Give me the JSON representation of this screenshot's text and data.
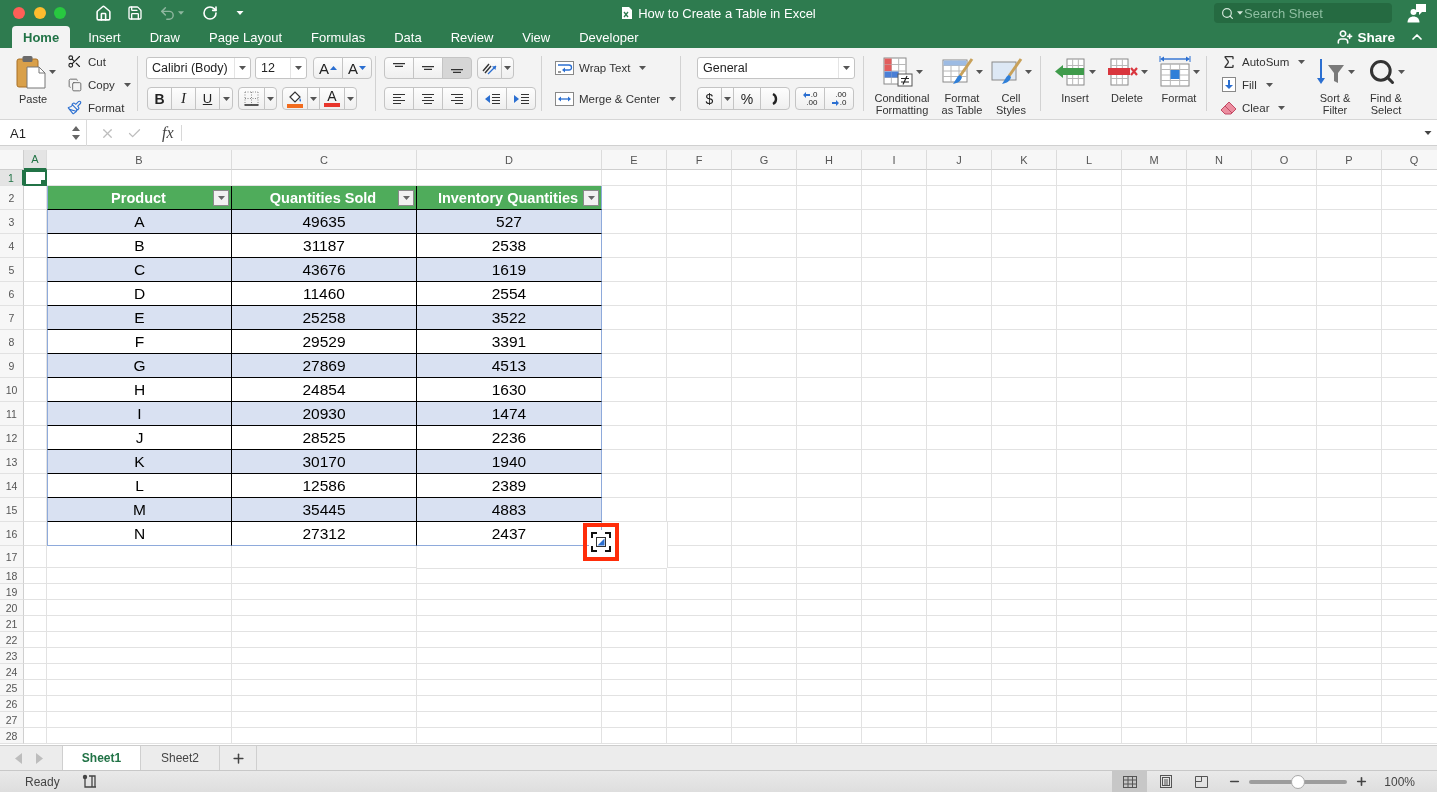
{
  "window": {
    "title": "How to Create a Table in Excel"
  },
  "search": {
    "placeholder": "Search Sheet"
  },
  "tabs": [
    {
      "label": "Home",
      "selected": true
    },
    {
      "label": "Insert",
      "selected": false
    },
    {
      "label": "Draw",
      "selected": false
    },
    {
      "label": "Page Layout",
      "selected": false
    },
    {
      "label": "Formulas",
      "selected": false
    },
    {
      "label": "Data",
      "selected": false
    },
    {
      "label": "Review",
      "selected": false
    },
    {
      "label": "View",
      "selected": false
    },
    {
      "label": "Developer",
      "selected": false
    }
  ],
  "share": {
    "label": "Share"
  },
  "ribbon": {
    "clipboard": {
      "paste": "Paste",
      "cut": "Cut",
      "copy": "Copy",
      "format": "Format"
    },
    "font": {
      "name": "Calibri (Body)",
      "size": "12",
      "grow": "A",
      "shrink": "A",
      "bold": "B",
      "italic": "I",
      "underline": "U",
      "font_color": "A"
    },
    "alignment": {
      "vertical": [
        {
          "kind": "top",
          "selected": false
        },
        {
          "kind": "middle",
          "selected": false
        },
        {
          "kind": "bottom",
          "selected": true
        }
      ],
      "wrap_text": "Wrap Text",
      "merge_center": "Merge & Center"
    },
    "number": {
      "format": "General",
      "currency": "$",
      "percent": "%",
      "increase_decimal": {
        "top": ".0",
        "bottom": ".00"
      },
      "decrease_decimal": {
        "top": ".00",
        "bottom": ".0"
      }
    },
    "styles": [
      {
        "kind": "conditional",
        "label": "Conditional Formatting"
      },
      {
        "kind": "table",
        "label": "Format as Table"
      },
      {
        "kind": "cell",
        "label": "Cell Styles"
      }
    ],
    "cells": [
      {
        "kind": "insert",
        "label": "Insert"
      },
      {
        "kind": "delete",
        "label": "Delete"
      },
      {
        "kind": "format",
        "label": "Format"
      }
    ],
    "editing": {
      "autosum": "AutoSum",
      "fill": "Fill",
      "clear": "Clear",
      "sort_filter": "Sort & Filter",
      "find_select": "Find & Select"
    }
  },
  "formula_bar": {
    "name_box": "A1",
    "function_label": "fx"
  },
  "sheet": {
    "columns": [
      {
        "label": "A",
        "selected": true
      },
      {
        "label": "B",
        "selected": false
      },
      {
        "label": "C",
        "selected": false
      },
      {
        "label": "D",
        "selected": false
      },
      {
        "label": "E",
        "selected": false
      },
      {
        "label": "F",
        "selected": false
      },
      {
        "label": "G",
        "selected": false
      },
      {
        "label": "H",
        "selected": false
      },
      {
        "label": "I",
        "selected": false
      },
      {
        "label": "J",
        "selected": false
      },
      {
        "label": "K",
        "selected": false
      },
      {
        "label": "L",
        "selected": false
      },
      {
        "label": "M",
        "selected": false
      },
      {
        "label": "N",
        "selected": false
      },
      {
        "label": "O",
        "selected": false
      },
      {
        "label": "P",
        "selected": false
      },
      {
        "label": "Q",
        "selected": false
      }
    ],
    "rows": [
      {
        "label": "1",
        "selected": true
      },
      {
        "label": "2",
        "selected": false
      },
      {
        "label": "3",
        "selected": false
      },
      {
        "label": "4",
        "selected": false
      },
      {
        "label": "5",
        "selected": false
      },
      {
        "label": "6",
        "selected": false
      },
      {
        "label": "7",
        "selected": false
      },
      {
        "label": "8",
        "selected": false
      },
      {
        "label": "9",
        "selected": false
      },
      {
        "label": "10",
        "selected": false
      },
      {
        "label": "11",
        "selected": false
      },
      {
        "label": "12",
        "selected": false
      },
      {
        "label": "13",
        "selected": false
      },
      {
        "label": "14",
        "selected": false
      },
      {
        "label": "15",
        "selected": false
      },
      {
        "label": "16",
        "selected": false
      },
      {
        "label": "17",
        "selected": false
      },
      {
        "label": "18",
        "selected": false
      },
      {
        "label": "19",
        "selected": false
      },
      {
        "label": "20",
        "selected": false
      },
      {
        "label": "21",
        "selected": false
      },
      {
        "label": "22",
        "selected": false
      },
      {
        "label": "23",
        "selected": false
      },
      {
        "label": "24",
        "selected": false
      },
      {
        "label": "25",
        "selected": false
      },
      {
        "label": "26",
        "selected": false
      },
      {
        "label": "27",
        "selected": false
      },
      {
        "label": "28",
        "selected": false
      }
    ]
  },
  "table": {
    "columns": [
      "Product",
      "Quantities Sold",
      "Inventory Quantities"
    ],
    "rows": [
      [
        "A",
        "49635",
        "527"
      ],
      [
        "B",
        "31187",
        "2538"
      ],
      [
        "C",
        "43676",
        "1619"
      ],
      [
        "D",
        "11460",
        "2554"
      ],
      [
        "E",
        "25258",
        "3522"
      ],
      [
        "F",
        "29529",
        "3391"
      ],
      [
        "G",
        "27869",
        "4513"
      ],
      [
        "H",
        "24854",
        "1630"
      ],
      [
        "I",
        "20930",
        "1474"
      ],
      [
        "J",
        "28525",
        "2236"
      ],
      [
        "K",
        "30170",
        "1940"
      ],
      [
        "L",
        "12586",
        "2389"
      ],
      [
        "M",
        "35445",
        "4883"
      ],
      [
        "N",
        "27312",
        "2437"
      ]
    ]
  },
  "sheet_tabs": [
    {
      "label": "Sheet1",
      "selected": true
    },
    {
      "label": "Sheet2",
      "selected": false
    }
  ],
  "status_bar": {
    "status": "Ready",
    "views": [
      {
        "kind": "normal",
        "selected": true
      },
      {
        "kind": "page_layout",
        "selected": false
      },
      {
        "kind": "page_break",
        "selected": false
      }
    ],
    "zoom": {
      "level": 0.5,
      "reading": "100%"
    }
  }
}
